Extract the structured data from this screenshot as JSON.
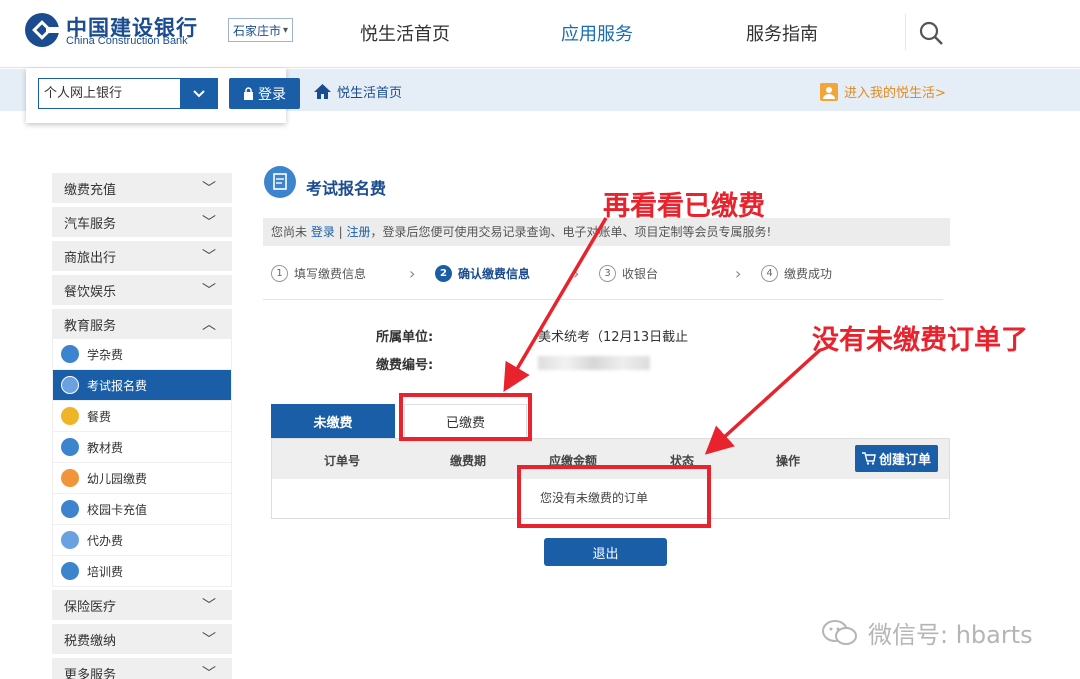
{
  "header": {
    "logo_cn": "中国建设银行",
    "logo_en": "China Construction Bank",
    "city": "石家庄市",
    "nav": [
      "悦生活首页",
      "应用服务",
      "服务指南"
    ],
    "active_nav_index": 1
  },
  "subbar": {
    "bank_select": "个人网上银行",
    "login_label": "登录",
    "home_link": "悦生活首页",
    "my_life_link": "进入我的悦生活>"
  },
  "sidebar": {
    "groups_top": [
      "缴费充值",
      "汽车服务",
      "商旅出行",
      "餐饮娱乐",
      "教育服务"
    ],
    "education_items": [
      {
        "label": "学杂费",
        "icon": "graduation-cap-icon",
        "color": "#3d84cf"
      },
      {
        "label": "考试报名费",
        "icon": "exam-icon",
        "color": "#3d84cf",
        "active": true
      },
      {
        "label": "餐费",
        "icon": "meal-icon",
        "color": "#f0b429"
      },
      {
        "label": "教材费",
        "icon": "book-icon",
        "color": "#3d84cf"
      },
      {
        "label": "幼儿园缴费",
        "icon": "kindergarten-icon",
        "color": "#f2943a"
      },
      {
        "label": "校园卡充值",
        "icon": "campus-card-icon",
        "color": "#3d84cf"
      },
      {
        "label": "代办费",
        "icon": "agency-icon",
        "color": "#6aa1e0"
      },
      {
        "label": "培训费",
        "icon": "training-icon",
        "color": "#3d84cf"
      }
    ],
    "groups_bottom": [
      "保险医疗",
      "税费缴纳",
      "更多服务"
    ]
  },
  "main": {
    "title": "考试报名费",
    "notice": {
      "prefix": "您尚未 ",
      "login": "登录",
      "sep": " | ",
      "register": "注册",
      "suffix": "，登录后您便可使用交易记录查询、电子对账单、项目定制等会员专属服务!"
    },
    "steps": [
      {
        "num": "1",
        "label": "填写缴费信息"
      },
      {
        "num": "2",
        "label": "确认缴费信息",
        "active": true
      },
      {
        "num": "3",
        "label": "收银台"
      },
      {
        "num": "4",
        "label": "缴费成功"
      }
    ],
    "info": {
      "unit_label": "所属单位:",
      "unit_value": "美术统考（12月13日截止",
      "code_label": "缴费编号:"
    },
    "tabs": {
      "unpaid": "未缴费",
      "paid": "已缴费"
    },
    "table": {
      "headers": [
        "订单号",
        "缴费期",
        "应缴金额",
        "状态",
        "操作"
      ],
      "create_btn": "创建订单",
      "empty_msg": "您没有未缴费的订单"
    },
    "exit_btn": "退出"
  },
  "annotations": {
    "note1": "再看看已缴费",
    "note2": "没有未缴费订单了",
    "color": "#e8232d"
  },
  "watermark": "微信号: hbarts"
}
